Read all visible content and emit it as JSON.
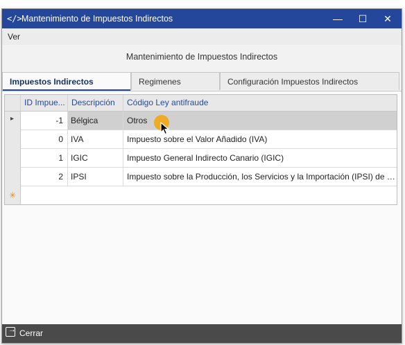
{
  "window": {
    "title": "Mantenimiento de Impuestos Indirectos",
    "app_icon": "</>",
    "controls": {
      "minimize": "—",
      "maximize": "☐",
      "close": "✕"
    }
  },
  "menu": {
    "items": [
      {
        "label": "Ver"
      }
    ]
  },
  "form": {
    "header": "Mantenimiento de Impuestos Indirectos"
  },
  "tabs": [
    {
      "label": "Impuestos Indirectos",
      "active": true
    },
    {
      "label": "Regimenes",
      "active": false
    },
    {
      "label": "Configuración Impuestos Indirectos",
      "active": false
    }
  ],
  "grid": {
    "columns": [
      "ID Impue...",
      "Descripción",
      "Código Ley antifraude"
    ],
    "rows": [
      {
        "id": "-1",
        "descripcion": "Bélgica",
        "ley": "Otros",
        "selected": true
      },
      {
        "id": "0",
        "descripcion": "IVA",
        "ley": "Impuesto sobre el Valor Añadido (IVA)",
        "selected": false
      },
      {
        "id": "1",
        "descripcion": "IGIC",
        "ley": "Impuesto General Indirecto Canario (IGIC)",
        "selected": false
      },
      {
        "id": "2",
        "descripcion": "IPSI",
        "ley": "Impuesto sobre la Producción, los Servicios y la Importación (IPSI) de Ce...",
        "selected": false
      }
    ],
    "current_row_marker": "▸",
    "new_row_marker": "✳"
  },
  "footer": {
    "close_label": "Cerrar"
  },
  "colors": {
    "titlebar": "#24479b",
    "footer": "#4a4a4a",
    "cursor_highlight": "#f1a91b"
  }
}
